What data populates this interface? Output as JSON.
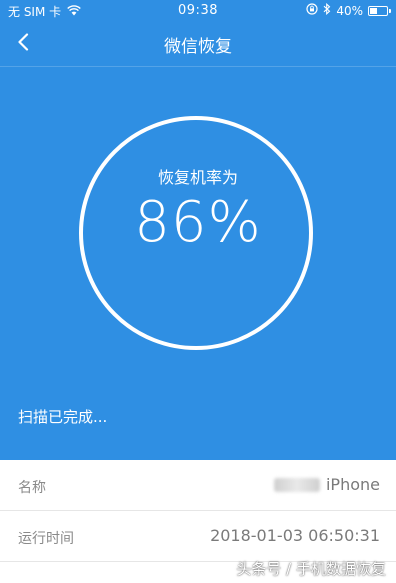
{
  "status_bar": {
    "carrier": "无 SIM 卡",
    "time": "09:38",
    "battery": "40%",
    "battery_level": 0.4,
    "icons": [
      "wifi-icon",
      "orientation-lock-icon",
      "bluetooth-icon",
      "battery-icon"
    ]
  },
  "nav": {
    "back_icon": "chevron-left-icon",
    "title": "微信恢复"
  },
  "hero": {
    "rate_label": "恢复机率为",
    "rate_value": "86%",
    "scan_status": "扫描已完成..."
  },
  "info": {
    "rows": [
      {
        "label": "名称",
        "value": "iPhone"
      },
      {
        "label": "运行时间",
        "value": "2018-01-03 06:50:31"
      }
    ]
  },
  "watermark": "头条号 / 手机数据恢复",
  "colors": {
    "primary": "#2f8fe3",
    "background": "#f5f5f5",
    "text_gray": "#8a8a8a"
  }
}
